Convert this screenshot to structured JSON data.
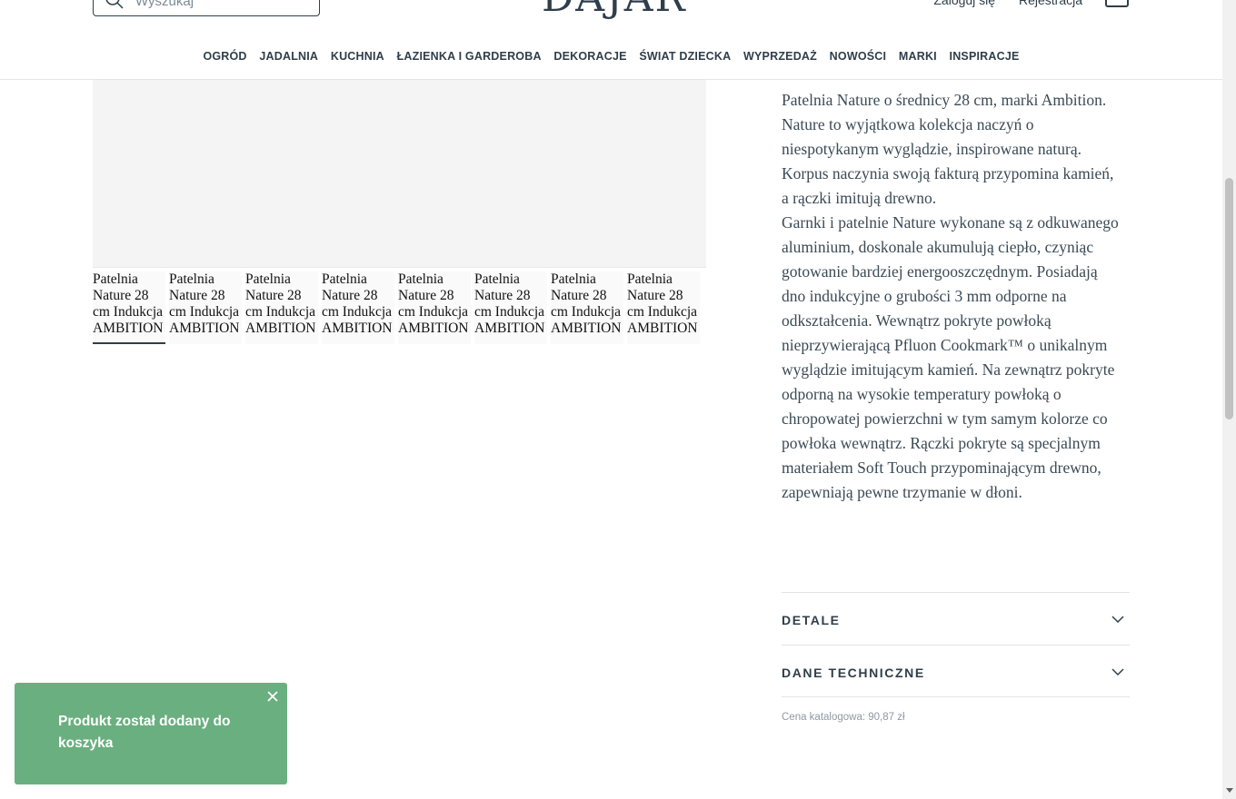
{
  "header": {
    "search_placeholder": "Wyszukaj",
    "logo": "DAJAR",
    "login_label": "Zaloguj się",
    "register_label": "Rejestracja",
    "nav": [
      "OGRÓD",
      "JADALNIA",
      "KUCHNIA",
      "ŁAZIENKA I GARDEROBA",
      "DEKORACJE",
      "ŚWIAT DZIECKA",
      "WYPRZEDAŻ",
      "NOWOŚCI",
      "MARKI",
      "INSPIRACJE"
    ]
  },
  "gallery": {
    "thumb_alt": "Patelnia Nature 28 cm Indukcja AMBITION"
  },
  "description": {
    "paragraphs": [
      "Patelnia Nature o średnicy 28 cm, marki Ambition.",
      "Nature to wyjątkowa kolekcja naczyń o niespotykanym wyglądzie, inspirowane naturą. Korpus naczynia swoją fakturą przypomina kamień, a rączki imitują drewno.",
      "Garnki i patelnie Nature wykonane są z odkuwanego aluminium, doskonale akumulują ciepło, czyniąc gotowanie bardziej energooszczędnym. Posiadają dno indukcyjne o grubości 3 mm odporne na odkształcenia. Wewnątrz pokryte powłoką nieprzywierającą Pfluon Cookmark™ o unikalnym wyglądzie imitującym kamień. Na zewnątrz pokryte odporną na wysokie temperatury powłoką o chropowatej powierzchni w tym samym kolorze co powłoka wewnątrz. Rączki pokryte są specjalnym materiałem Soft Touch przypominającym drewno, zapewniają pewne trzymanie w dłoni."
    ]
  },
  "accordions": {
    "details_label": "DETALE",
    "technical_label": "DANE TECHNICZNE"
  },
  "catalog_price": "Cena katalogowa: 90,87 zł",
  "toast": {
    "message": "Produkt został dodany do koszyka"
  },
  "colors": {
    "toast_bg": "#6aaf7f",
    "text_dark": "#2f3e4a"
  }
}
